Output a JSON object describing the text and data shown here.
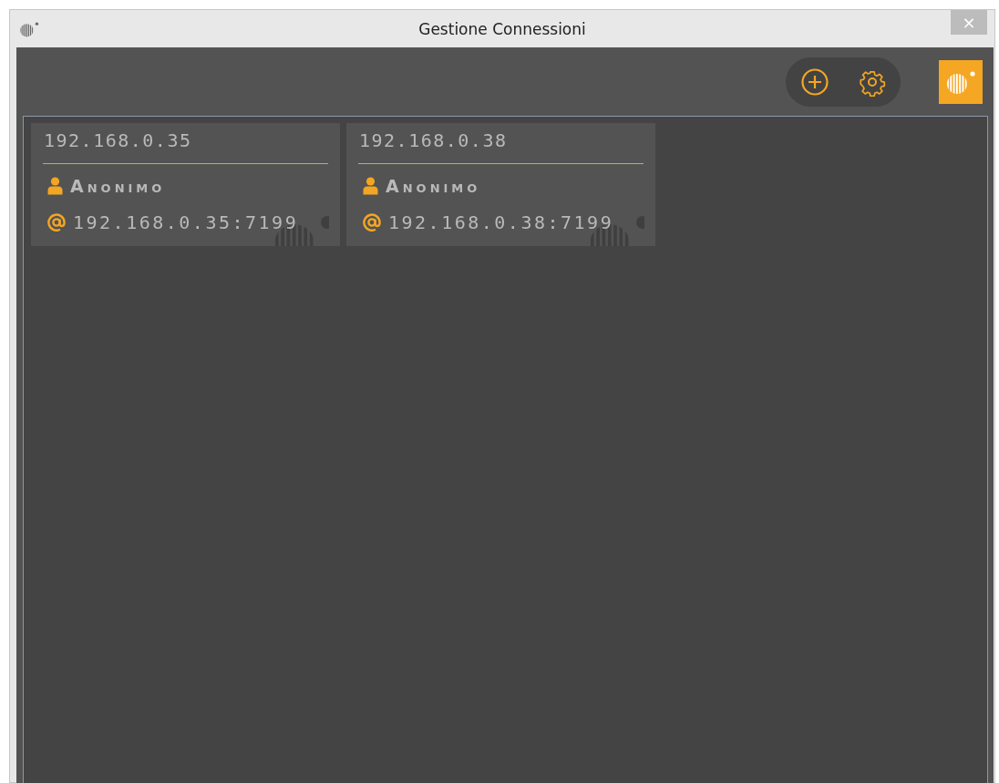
{
  "window": {
    "title": "Gestione Connessioni",
    "close": "×"
  },
  "connections": [
    {
      "host": "192.168.0.35",
      "user": "Anonimo",
      "address": "192.168.0.35:7199"
    },
    {
      "host": "192.168.0.38",
      "user": "Anonimo",
      "address": "192.168.0.38:7199"
    }
  ]
}
